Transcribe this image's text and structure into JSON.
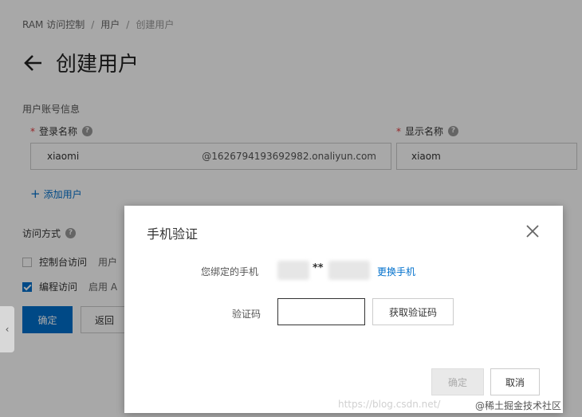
{
  "breadcrumb": {
    "root": "RAM 访问控制",
    "sep1": "/",
    "mid": "用户",
    "sep2": "/",
    "current": "创建用户"
  },
  "page": {
    "title": "创建用户"
  },
  "section": {
    "account_info": "用户账号信息"
  },
  "form": {
    "login_name_label": "登录名称",
    "login_name_value": "xiaomi",
    "login_name_suffix": "@1626794193692982.onaliyun.com",
    "display_name_label": "显示名称",
    "display_name_value": "xiaom",
    "required_mark": "*",
    "help_icon": "?",
    "add_user": "添加用户",
    "add_plus": "+"
  },
  "access": {
    "label": "访问方式",
    "console_access": "控制台访问",
    "console_hint": "用户",
    "programmatic_access": "编程访问",
    "programmatic_hint": "启用 A",
    "console_checked": false,
    "programmatic_checked": true
  },
  "buttons": {
    "confirm": "确定",
    "back": "返回"
  },
  "side_tab": {
    "arrow": "‹"
  },
  "dialog": {
    "title": "手机验证",
    "bound_phone_label": "您绑定的手机",
    "phone_mask": "**",
    "change_phone": "更换手机",
    "code_label": "验证码",
    "code_value": "",
    "get_code": "获取验证码",
    "ok": "确定",
    "cancel": "取消"
  },
  "watermark": {
    "url": "https://blog.csdn.net/",
    "brand": "@稀土掘金技术社区"
  },
  "colors": {
    "accent": "#0070cc",
    "required": "#e4393c",
    "overlay": "rgba(0,0,0,0.34)"
  },
  "icons": {
    "back": "back-arrow-icon",
    "close": "close-icon",
    "help": "help-icon",
    "check": "check-icon"
  }
}
